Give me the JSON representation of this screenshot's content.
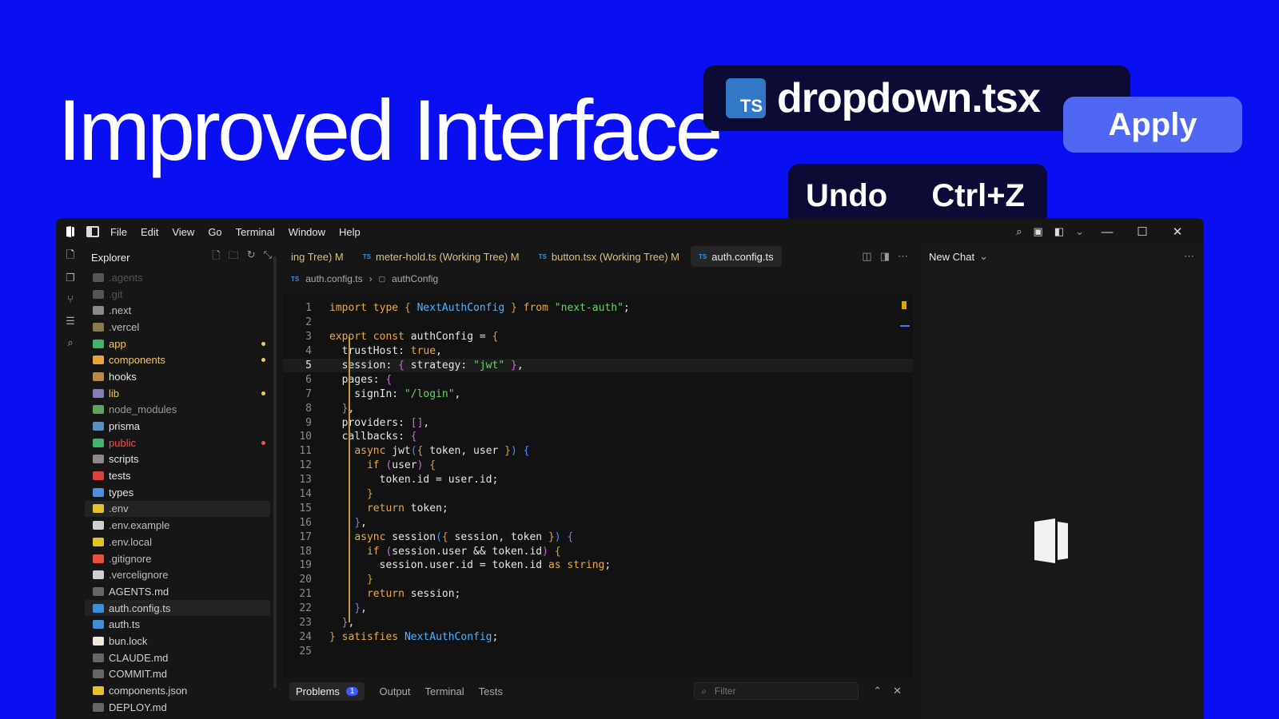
{
  "hero": {
    "title": "Improved Interface",
    "file_chip": {
      "badge": "TS",
      "name": "dropdown.tsx"
    },
    "apply_label": "Apply",
    "undo_label": "Undo",
    "undo_shortcut": "Ctrl+Z"
  },
  "menu": [
    "File",
    "Edit",
    "View",
    "Go",
    "Terminal",
    "Window",
    "Help"
  ],
  "explorer": {
    "title": "Explorer",
    "items": [
      {
        "name": ".agents",
        "color": "#555555",
        "icon": "#555555"
      },
      {
        "name": ".git",
        "color": "#555555",
        "icon": "#555555"
      },
      {
        "name": ".next",
        "color": "#bdbdbd",
        "icon": "#8a8a8a"
      },
      {
        "name": ".vercel",
        "color": "#bdbdbd",
        "icon": "#8a7a50"
      },
      {
        "name": "app",
        "color": "#f0c960",
        "icon": "#3fb56b",
        "dot": "#f0c960"
      },
      {
        "name": "components",
        "color": "#f0c960",
        "icon": "#e8a63a",
        "dot": "#f0c960"
      },
      {
        "name": "hooks",
        "color": "#e6e6e6",
        "icon": "#b88b4a"
      },
      {
        "name": "lib",
        "color": "#f0c960",
        "icon": "#8a7ab8",
        "dot": "#f0c960"
      },
      {
        "name": "node_modules",
        "color": "#9a9a9a",
        "icon": "#5fa35f"
      },
      {
        "name": "prisma",
        "color": "#e6e6e6",
        "icon": "#5a8fc0"
      },
      {
        "name": "public",
        "color": "#ef5350",
        "icon": "#3fb56b",
        "dot": "#ef5350"
      },
      {
        "name": "scripts",
        "color": "#e6e6e6",
        "icon": "#8a8a8a"
      },
      {
        "name": "tests",
        "color": "#e6e6e6",
        "icon": "#d9443a"
      },
      {
        "name": "types",
        "color": "#e6e6e6",
        "icon": "#4f8fe0"
      },
      {
        "name": ".env",
        "color": "#bdbdbd",
        "icon": "#e6c229",
        "sel": true
      },
      {
        "name": ".env.example",
        "color": "#bdbdbd",
        "icon": "#cfcfcf"
      },
      {
        "name": ".env.local",
        "color": "#bdbdbd",
        "icon": "#e6c229"
      },
      {
        "name": ".gitignore",
        "color": "#bdbdbd",
        "icon": "#e5533c"
      },
      {
        "name": ".vercelignore",
        "color": "#bdbdbd",
        "icon": "#cfcfcf"
      },
      {
        "name": "AGENTS.md",
        "color": "#d0d0d0",
        "icon": "#666666"
      },
      {
        "name": "auth.config.ts",
        "color": "#d0d0d0",
        "icon": "#3d8fd8",
        "sel": true
      },
      {
        "name": "auth.ts",
        "color": "#d0d0d0",
        "icon": "#3d8fd8"
      },
      {
        "name": "bun.lock",
        "color": "#d0d0d0",
        "icon": "#f2e8d8"
      },
      {
        "name": "CLAUDE.md",
        "color": "#d0d0d0",
        "icon": "#666666"
      },
      {
        "name": "COMMIT.md",
        "color": "#d0d0d0",
        "icon": "#666666"
      },
      {
        "name": "components.json",
        "color": "#d0d0d0",
        "icon": "#e6c229"
      },
      {
        "name": "DEPLOY.md",
        "color": "#d0d0d0",
        "icon": "#666666"
      }
    ]
  },
  "tabs": [
    {
      "label": "ing Tree) M",
      "ts": false
    },
    {
      "label": "meter-hold.ts (Working Tree) M",
      "ts": true
    },
    {
      "label": "button.tsx (Working Tree) M",
      "ts": true
    },
    {
      "label": "auth.config.ts",
      "ts": true,
      "active": true
    }
  ],
  "breadcrumb": {
    "file": "auth.config.ts",
    "symbol": "authConfig"
  },
  "code_lines": [
    [
      [
        "kw",
        "import"
      ],
      [
        "pl",
        " "
      ],
      [
        "kw",
        "type"
      ],
      [
        "pl",
        " "
      ],
      [
        "br",
        "{"
      ],
      [
        "pl",
        " "
      ],
      [
        "ty",
        "NextAuthConfig"
      ],
      [
        "pl",
        " "
      ],
      [
        "br",
        "}"
      ],
      [
        "pl",
        " "
      ],
      [
        "kw",
        "from"
      ],
      [
        "pl",
        " "
      ],
      [
        "st",
        "\"next-auth\""
      ],
      [
        "pl",
        ";"
      ]
    ],
    [],
    [
      [
        "kw",
        "export"
      ],
      [
        "pl",
        " "
      ],
      [
        "kw",
        "const"
      ],
      [
        "pl",
        " authConfig = "
      ],
      [
        "br",
        "{"
      ]
    ],
    [
      [
        "pl",
        "  trustHost: "
      ],
      [
        "kw",
        "true"
      ],
      [
        "pl",
        ","
      ]
    ],
    [
      [
        "pl",
        "  session: "
      ],
      [
        "bp",
        "{"
      ],
      [
        "pl",
        " strategy: "
      ],
      [
        "st",
        "\"jwt\""
      ],
      [
        "pl",
        " "
      ],
      [
        "bp",
        "}"
      ],
      [
        "pl",
        ","
      ]
    ],
    [
      [
        "pl",
        "  pages: "
      ],
      [
        "bp",
        "{"
      ]
    ],
    [
      [
        "pl",
        "    signIn: "
      ],
      [
        "st",
        "\"/login\""
      ],
      [
        "pl",
        ","
      ]
    ],
    [
      [
        "pl",
        "  "
      ],
      [
        "bp",
        "}"
      ],
      [
        "pl",
        ","
      ]
    ],
    [
      [
        "pl",
        "  providers: "
      ],
      [
        "bp",
        "[]"
      ],
      [
        "pl",
        ","
      ]
    ],
    [
      [
        "pl",
        "  callbacks: "
      ],
      [
        "bp",
        "{"
      ]
    ],
    [
      [
        "pl",
        "    "
      ],
      [
        "kw",
        "async"
      ],
      [
        "pl",
        " jwt"
      ],
      [
        "bb",
        "("
      ],
      [
        "br",
        "{"
      ],
      [
        "pl",
        " token, user "
      ],
      [
        "br",
        "}"
      ],
      [
        "bb",
        ")"
      ],
      [
        "pl",
        " "
      ],
      [
        "bb",
        "{"
      ]
    ],
    [
      [
        "pl",
        "      "
      ],
      [
        "kw",
        "if"
      ],
      [
        "pl",
        " "
      ],
      [
        "bp",
        "("
      ],
      [
        "pl",
        "user"
      ],
      [
        "bp",
        ")"
      ],
      [
        "pl",
        " "
      ],
      [
        "br",
        "{"
      ]
    ],
    [
      [
        "pl",
        "        token.id = user.id;"
      ]
    ],
    [
      [
        "pl",
        "      "
      ],
      [
        "br",
        "}"
      ]
    ],
    [
      [
        "pl",
        "      "
      ],
      [
        "kw",
        "return"
      ],
      [
        "pl",
        " token;"
      ]
    ],
    [
      [
        "pl",
        "    "
      ],
      [
        "bb",
        "}"
      ],
      [
        "pl",
        ","
      ]
    ],
    [
      [
        "pl",
        "    "
      ],
      [
        "kw",
        "async"
      ],
      [
        "pl",
        " session"
      ],
      [
        "bb",
        "("
      ],
      [
        "br",
        "{"
      ],
      [
        "pl",
        " session, token "
      ],
      [
        "br",
        "}"
      ],
      [
        "bb",
        ")"
      ],
      [
        "pl",
        " "
      ],
      [
        "bb",
        "{"
      ]
    ],
    [
      [
        "pl",
        "      "
      ],
      [
        "kw",
        "if"
      ],
      [
        "pl",
        " "
      ],
      [
        "bp",
        "("
      ],
      [
        "pl",
        "session.user && token.id"
      ],
      [
        "bp",
        ")"
      ],
      [
        "pl",
        " "
      ],
      [
        "br",
        "{"
      ]
    ],
    [
      [
        "pl",
        "        session.user.id = token.id "
      ],
      [
        "kw",
        "as"
      ],
      [
        "pl",
        " "
      ],
      [
        "kw",
        "string"
      ],
      [
        "pl",
        ";"
      ]
    ],
    [
      [
        "pl",
        "      "
      ],
      [
        "br",
        "}"
      ]
    ],
    [
      [
        "pl",
        "      "
      ],
      [
        "kw",
        "return"
      ],
      [
        "pl",
        " session;"
      ]
    ],
    [
      [
        "pl",
        "    "
      ],
      [
        "bb",
        "}"
      ],
      [
        "pl",
        ","
      ]
    ],
    [
      [
        "pl",
        "  "
      ],
      [
        "bp",
        "}"
      ],
      [
        "pl",
        ","
      ]
    ],
    [
      [
        "br",
        "}"
      ],
      [
        "pl",
        " "
      ],
      [
        "kw",
        "satisfies"
      ],
      [
        "pl",
        " "
      ],
      [
        "ty",
        "NextAuthConfig"
      ],
      [
        "pl",
        ";"
      ]
    ],
    []
  ],
  "current_line": 5,
  "panel": {
    "tabs": [
      "Problems",
      "Output",
      "Terminal",
      "Tests"
    ],
    "problems_count": "1",
    "filter_placeholder": "Filter"
  },
  "chat": {
    "title": "New Chat"
  }
}
